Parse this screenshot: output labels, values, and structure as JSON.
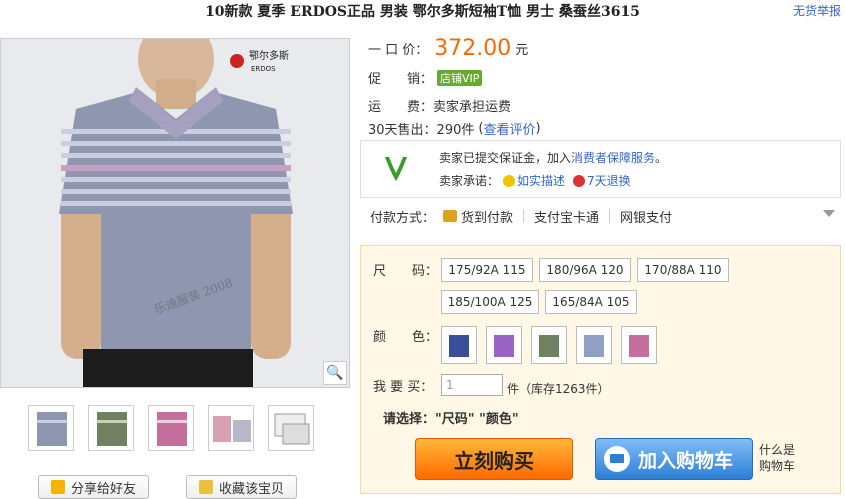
{
  "header": {
    "title": "10新款 夏季 ERDOS正品 男装 鄂尔多斯短袖T恤 男士 桑蚕丝3615",
    "report_link": "无货举报"
  },
  "gallery": {
    "brand_cn": "鄂尔多斯",
    "brand_en": "ERDOS",
    "watermark": "乐迪服装 2008",
    "zoom_icon": "magnifier-icon"
  },
  "actions": {
    "share": "分享给好友",
    "favorite": "收藏该宝贝"
  },
  "info": {
    "price_label": "一 口 价：",
    "price": "372.00",
    "price_unit": "元",
    "promo_label": "促　　销：",
    "promo_badge": "店铺VIP",
    "shipping_label": "运　　费：",
    "shipping_value": "卖家承担运费",
    "sold_label": "30天售出：",
    "sold_value": "290件",
    "review_link": "查看评价"
  },
  "guarantee": {
    "line1_prefix": "卖家已提交保证金，加入",
    "line1_link": "消费者保障服务",
    "line1_suffix": "。",
    "promise_label": "卖家承诺：",
    "promise_1": "如实描述",
    "promise_2": "7天退换"
  },
  "payment": {
    "label": "付款方式：",
    "methods": [
      "货到付款",
      "支付宝卡通",
      "网银支付"
    ]
  },
  "options": {
    "size_label": "尺　　码：",
    "sizes": [
      "175/92A 115",
      "180/96A 120",
      "170/88A 110",
      "185/100A 125",
      "165/84A 105"
    ],
    "color_label": "颜　　色：",
    "color_swatches": [
      "#3a4f9a",
      "#9b63c4",
      "#6f8160",
      "#8fa0c4",
      "#c4709c"
    ],
    "qty_label": "我 要 买：",
    "qty_value": "1",
    "qty_unit": "件",
    "stock": "（库存1263件）",
    "select_label": "请选择：",
    "select_hint": "\"尺码\" \"颜色\"",
    "buy_now": "立刻购买",
    "add_cart": "加入购物车",
    "whats_cart_1": "什么是",
    "whats_cart_2": "购物车"
  }
}
